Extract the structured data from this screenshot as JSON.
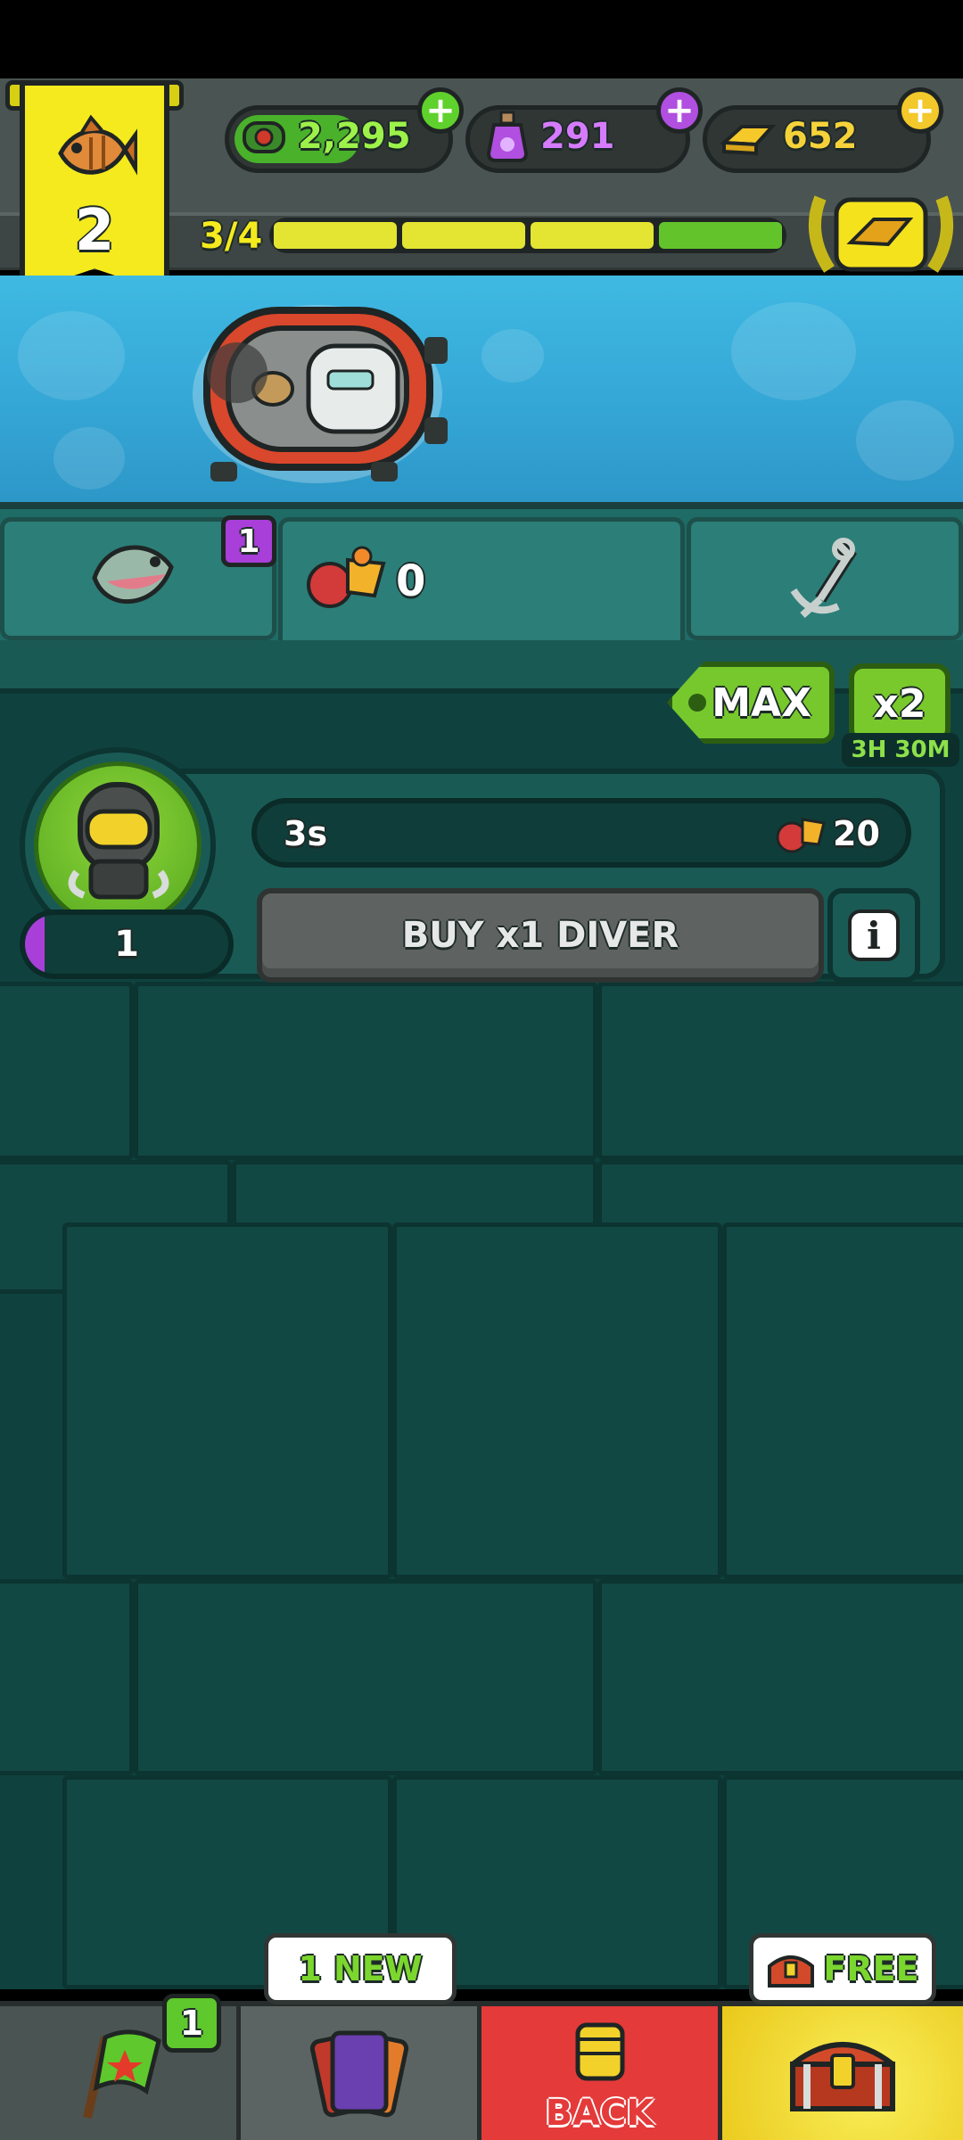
{
  "header": {
    "level": "2",
    "currencies": [
      {
        "name": "green-cash",
        "value": "2,295",
        "color": "#7bd62e"
      },
      {
        "name": "potion",
        "value": "291",
        "color": "#d67bff"
      },
      {
        "name": "gold",
        "value": "652",
        "color": "#f6d23a"
      }
    ],
    "progress_text": "3/4",
    "progress_segments": [
      "yellow",
      "yellow",
      "yellow",
      "green"
    ]
  },
  "tabs": {
    "gems_value": "0",
    "fish_badge": "1"
  },
  "boost": {
    "max_label": "MAX",
    "x2_label": "x2",
    "x2_time": "3H 30M"
  },
  "diver": {
    "timer": "3s",
    "reward": "20",
    "count": "1",
    "buy_label": "BUY x1 DIVER",
    "info_label": "i"
  },
  "bottom_nav": {
    "flag_badge": "1",
    "cards_label": "1 NEW",
    "back_label": "BACK",
    "chest_label": "FREE"
  }
}
